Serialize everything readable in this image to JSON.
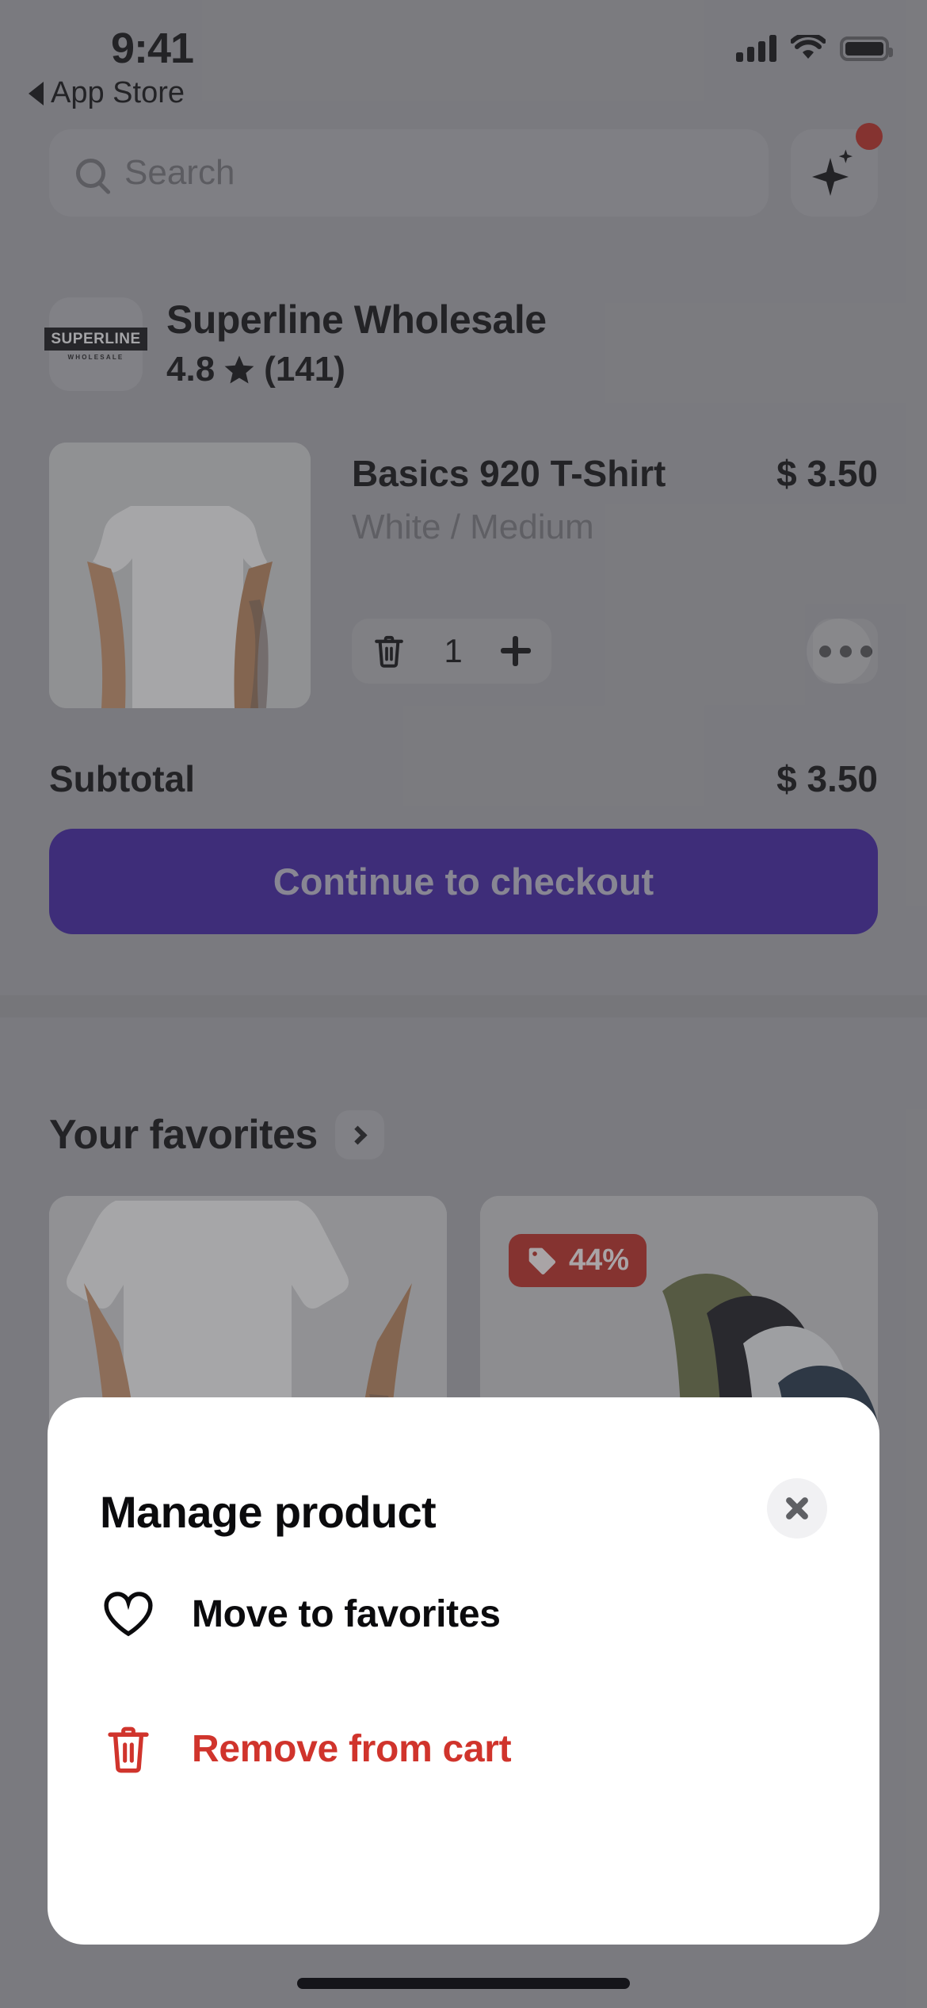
{
  "status_bar": {
    "time": "9:41",
    "back_label": "App Store",
    "back_icon": "triangle-left-icon",
    "signal_icon": "cellular-signal-icon",
    "wifi_icon": "wifi-icon",
    "battery_icon": "battery-full-icon"
  },
  "search": {
    "placeholder": "Search",
    "icon": "search-icon",
    "ai_button_icon": "sparkle-icon",
    "ai_badge": true
  },
  "store": {
    "logo_text": "SUPERLINE",
    "logo_subtext": "WHOLESALE",
    "name": "Superline Wholesale",
    "rating": "4.8",
    "star_icon": "star-filled-icon",
    "review_count": "(141)"
  },
  "cart_item": {
    "title": "Basics 920 T-Shirt",
    "variant": "White / Medium",
    "price": "$ 3.50",
    "quantity": "1",
    "delete_icon": "trash-icon",
    "increase_icon": "plus-icon",
    "more_icon": "ellipsis-icon",
    "image_alt": "white-tshirt-thumbnail"
  },
  "summary": {
    "subtotal_label": "Subtotal",
    "subtotal_value": "$ 3.50",
    "checkout_label": "Continue to checkout",
    "checkout_color": "#3a1d9c",
    "checkout_text_color": "#b9b6c9"
  },
  "favorites": {
    "title": "Your favorites",
    "chevron_icon": "chevron-right-icon",
    "cards": [
      {
        "alt": "white-tshirt-card",
        "badge": null
      },
      {
        "alt": "tshirt-stack-card",
        "badge": "44%",
        "badge_icon": "price-tag-icon",
        "badge_color": "#b3261e"
      }
    ]
  },
  "modal": {
    "title": "Manage product",
    "close_icon": "close-icon",
    "items": [
      {
        "label": "Move to favorites",
        "icon": "heart-outline-icon",
        "color": "#0b0b0d"
      },
      {
        "label": "Remove from cart",
        "icon": "trash-icon",
        "color": "#d0342c"
      }
    ]
  }
}
